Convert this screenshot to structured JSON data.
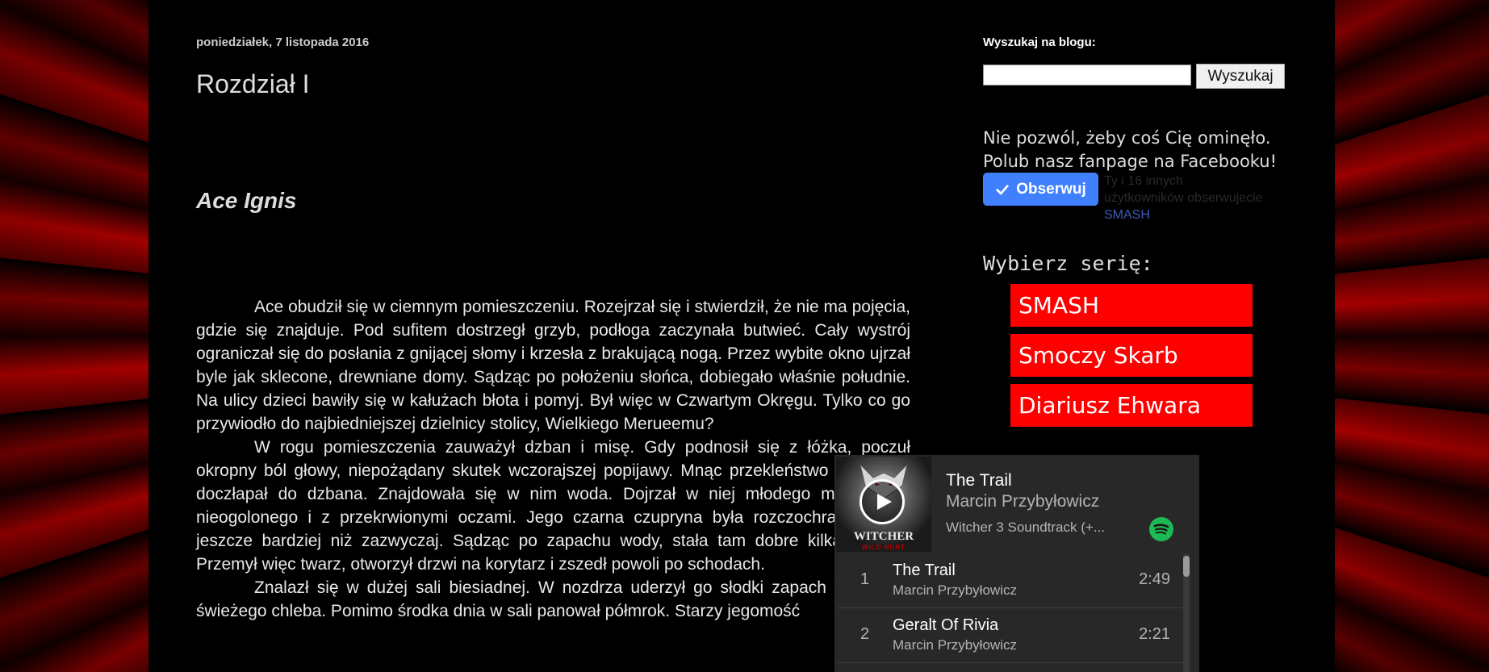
{
  "post": {
    "date": "poniedziałek, 7 listopada 2016",
    "title": "Rozdział I",
    "subtitle": "Ace Ignis",
    "paragraphs": [
      "Ace obudził się w ciemnym pomieszczeniu. Rozejrzał się i stwierdził, że nie ma pojęcia, gdzie się znajduje. Pod sufitem dostrzegł grzyb, podłoga zaczynała butwieć. Cały wystrój ograniczał się do posłania z gnijącej słomy i krzesła z brakującą nogą. Przez wybite okno ujrzał byle jak sklecone, drewniane domy. Sądząc po położeniu słońca, dobiegało właśnie południe. Na ulicy dzieci bawiły się w kałużach błota i pomyj. Był więc w Czwartym Okręgu. Tylko co go przywiodło do najbiedniejszej dzielnicy stolicy, Wielkiego Merueemu?",
      "W rogu pomieszczenia zauważył dzban i misę. Gdy podnosił się z łóżka, poczuł okropny ból głowy, niepożądany skutek wczorajszej popijawy. Mnąc przekleństwo w ustach, doczłapał do dzbana. Znajdowała się w nim woda. Dojrzał w niej młodego mężczyznę, nieogolonego i z przekrwionymi oczami. Jego czarna czupryna była rozczochrana chyba jeszcze bardziej niż zazwyczaj. Sądząc po zapachu wody, stała tam dobre kilka tygodni. Przemył więc twarz, otworzył drzwi na korytarz i zszedł powoli po schodach.",
      "Znalazł się w dużej sali biesiadnej. W nozdrza uderzył go słodki zapach wina oraz świeżego chleba. Pomimo środka dnia w sali panował półmrok. Starzy jegomość"
    ]
  },
  "sidebar": {
    "search_label": "Wyszukaj na blogu:",
    "search_value": "",
    "search_button": "Wyszukaj",
    "fanpage_line1": "Nie pozwól, żeby coś Cię ominęło.",
    "fanpage_line2": "Polub nasz fanpage na Facebooku!",
    "follow_button": "Obserwuj",
    "follow_info": "Ty i 16 innych użytkowników obserwujecie",
    "follow_link": "SMASH",
    "series_heading": "Wybierz serię:",
    "series": [
      "SMASH",
      "Smoczy Skarb",
      "Diariusz Ehwara"
    ]
  },
  "spotify": {
    "title": "The Trail",
    "artist": "Marcin Przybyłowicz",
    "album": "Witcher 3 Soundtrack (+...",
    "cover_text": "WITCHER",
    "cover_sub": "WILD HUNT",
    "tracks": [
      {
        "num": "1",
        "name": "The Trail",
        "artist": "Marcin Przybyłowicz",
        "duration": "2:49"
      },
      {
        "num": "2",
        "name": "Geralt Of Rivia",
        "artist": "Marcin Przybyłowicz",
        "duration": "2:21"
      }
    ]
  },
  "colors": {
    "series_button": "#ff0000",
    "follow_button": "#4080ff",
    "spotify_green": "#1db954"
  }
}
